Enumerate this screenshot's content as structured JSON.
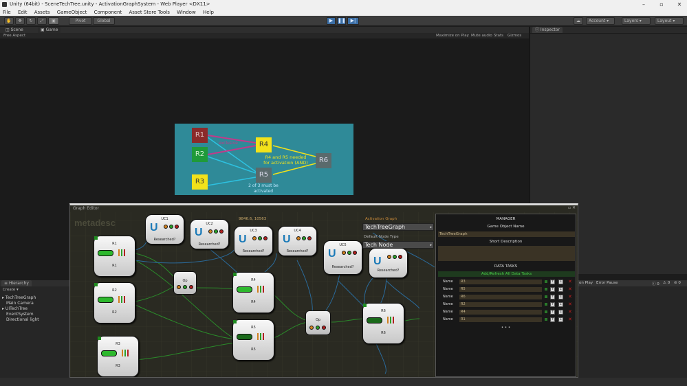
{
  "window": {
    "title": "Unity (64bit) - SceneTechTree.unity - ActivationGraphSystem - Web Player <DX11>"
  },
  "menu": [
    "File",
    "Edit",
    "Assets",
    "GameObject",
    "Component",
    "Asset Store Tools",
    "Window",
    "Help"
  ],
  "toolbar": {
    "pivot": "Pivot",
    "global": "Global",
    "account": "Account",
    "layers": "Layers",
    "layout": "Layout"
  },
  "tabs": {
    "scene": "Scene",
    "game": "Game",
    "inspector": "Inspector",
    "hierarchy": "Hierarchy"
  },
  "game_bar": {
    "aspect": "Free Aspect",
    "maximize": "Maximize on Play",
    "mute": "Mute audio",
    "stats": "Stats",
    "gizmos": "Gizmos"
  },
  "hierarchy": {
    "create": "Create",
    "items": [
      "TechTreeGraph",
      "Main Camera",
      "UITechTree",
      "EventSystem",
      "Directional light"
    ]
  },
  "console": {
    "clear_on_play": "on Play",
    "error_pause": "Error Pause",
    "counts": [
      "0",
      "0",
      "0"
    ]
  },
  "tech_image": {
    "nodes": [
      "R1",
      "R2",
      "R3",
      "R4",
      "R5",
      "R6"
    ],
    "label_exclusive": "exclusive",
    "label_and_1": "R4 and R5 needed",
    "label_and_2": "for activation (AND)",
    "label_2of3_1": "2 of 3 must be",
    "label_2of3_2": "activated",
    "colors": {
      "r1": "#8b2a2a",
      "r2": "#1f9a3a",
      "r3": "#f2e21a",
      "r4": "#f2e21a",
      "r5": "#5a6a6c",
      "r6": "#5a6a6c",
      "bg": "#2f8a98"
    }
  },
  "graph_editor": {
    "title": "Graph Editor",
    "logo": "metadesc",
    "coords": "9846.6, 10563",
    "uc_nodes": [
      {
        "name": "UC1",
        "label": "Researched?"
      },
      {
        "name": "UC2",
        "label": "Researched?"
      },
      {
        "name": "UC3",
        "label": "Researched?"
      },
      {
        "name": "UC4",
        "label": "Researched?"
      },
      {
        "name": "UC5",
        "label": "Researched?"
      },
      {
        "name": "",
        "label": "Researched?"
      }
    ],
    "r_nodes": [
      {
        "top": "R1",
        "bottom": "R1"
      },
      {
        "top": "R2",
        "bottom": "R2"
      },
      {
        "top": "R3",
        "bottom": "R3"
      },
      {
        "top": "R4",
        "bottom": "R4"
      },
      {
        "top": "R5",
        "bottom": "R5"
      },
      {
        "top": "R6",
        "bottom": "R6"
      }
    ],
    "op_label": "Op",
    "activation_graph_label": "Activation Graph",
    "activation_graph_value": "TechTreeGraph",
    "default_node_type_label": "Default Node Type",
    "default_node_type_value": "Tech Node"
  },
  "manager": {
    "title": "MANAGER",
    "go_name_label": "Game Object Name",
    "go_name_value": "TechTreeGraph",
    "short_desc_label": "Short Description",
    "data_tasks_label": "DATA TASKS",
    "refresh_label": "Add/Refresh All Data Tasks",
    "row_label": "Name",
    "rows": [
      "R3",
      "R5",
      "R6",
      "R2",
      "R4",
      "R1"
    ],
    "more": "• • •"
  }
}
